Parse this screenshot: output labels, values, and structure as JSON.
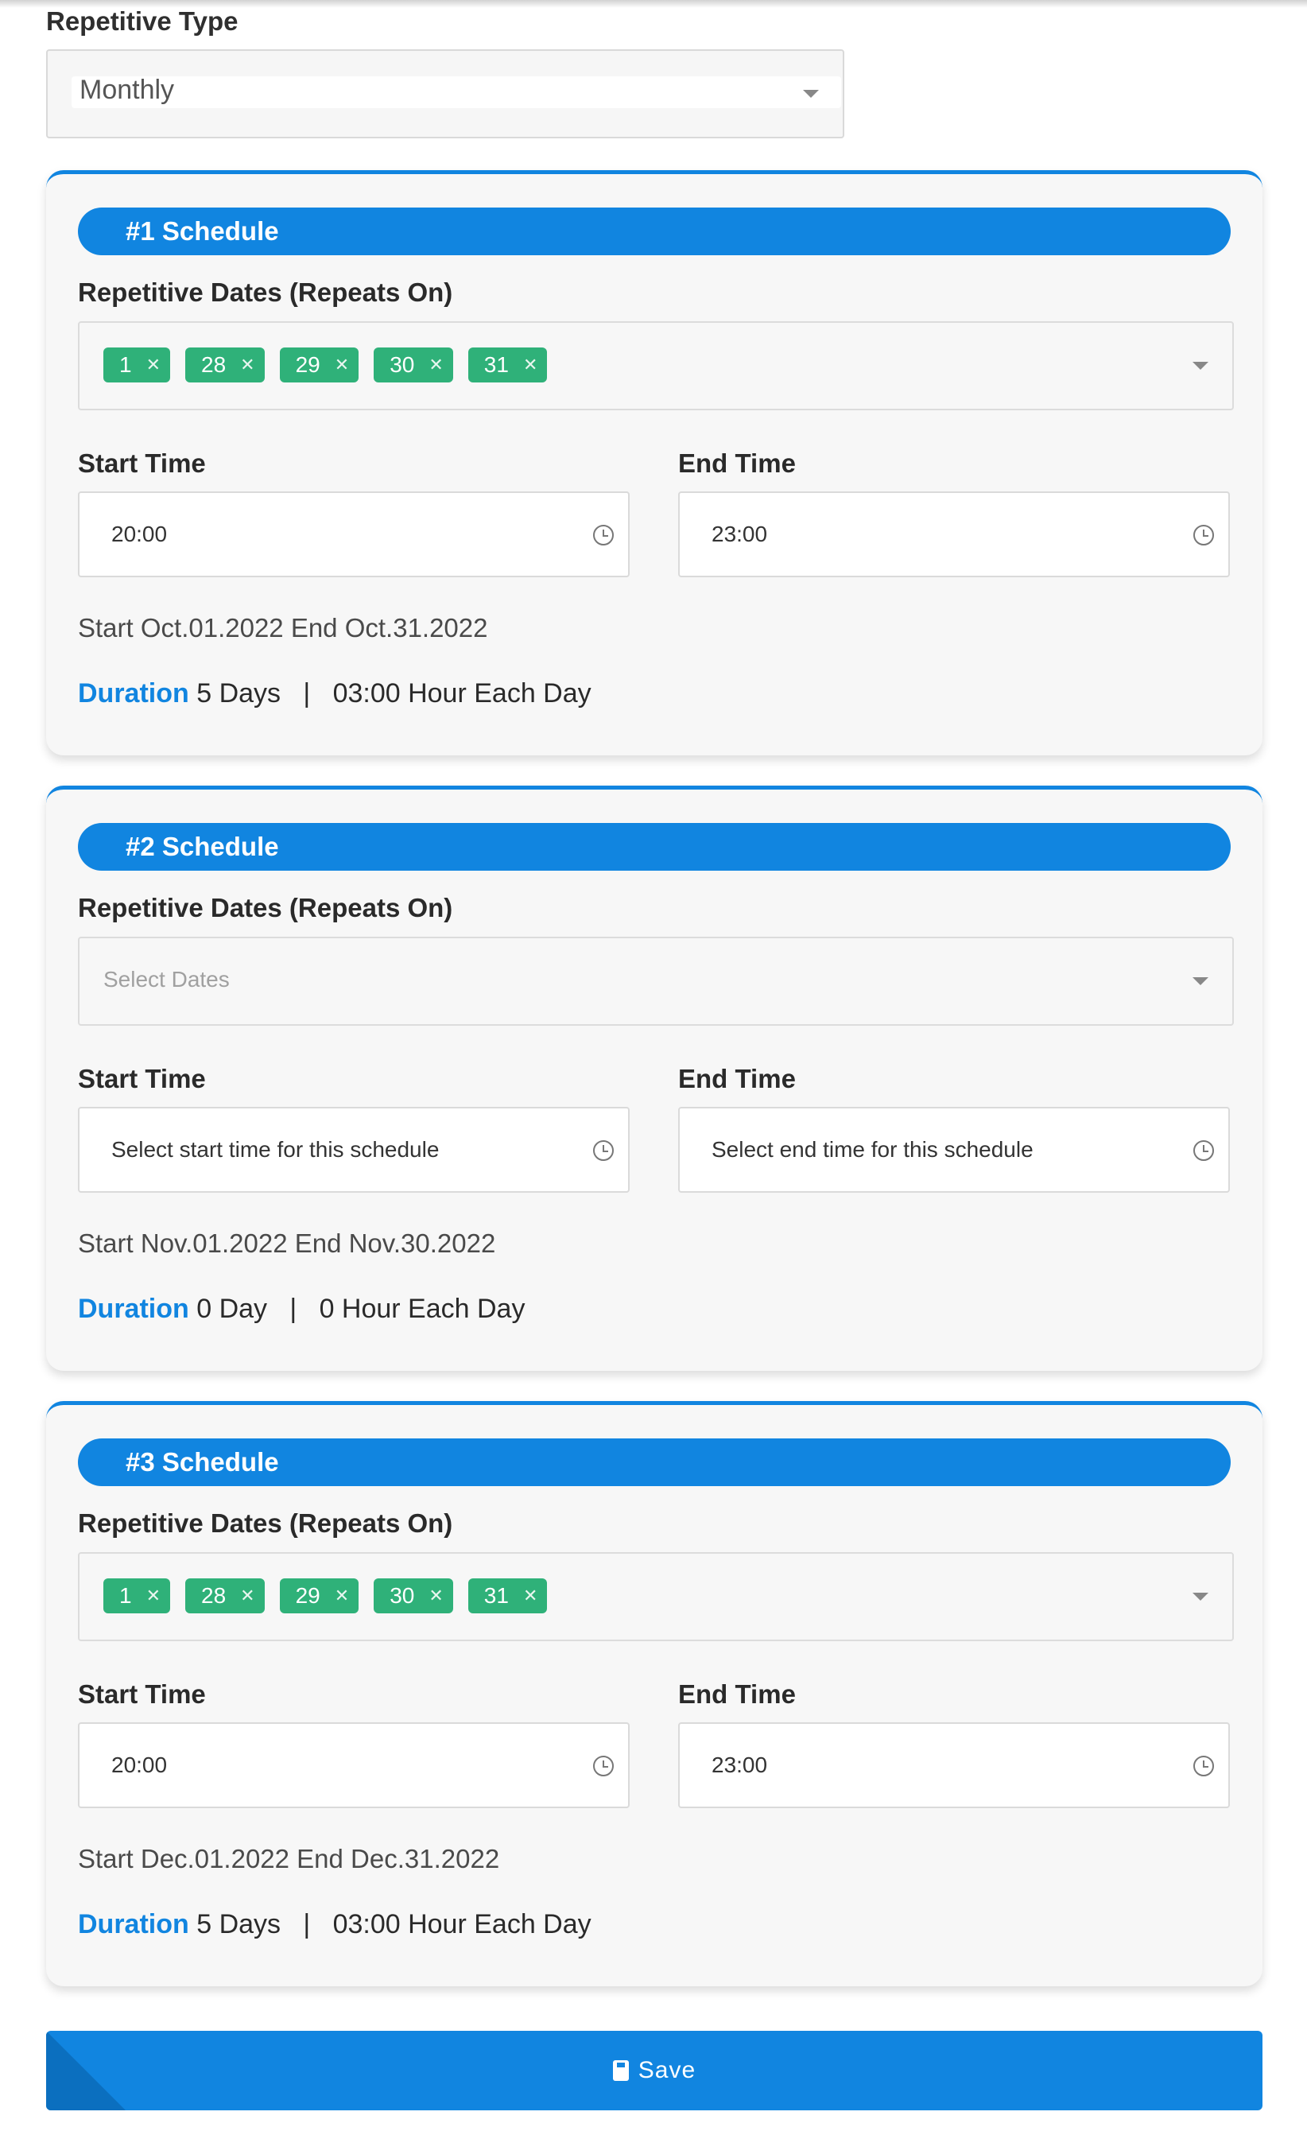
{
  "repetitive_type": {
    "label": "Repetitive Type",
    "value": "Monthly"
  },
  "schedules": [
    {
      "title": "#1 Schedule",
      "dates_label": "Repetitive Dates (Repeats On)",
      "dates": [
        "1",
        "28",
        "29",
        "30",
        "31"
      ],
      "dates_placeholder": "",
      "start_label": "Start Time",
      "start_time": "20:00",
      "end_label": "End Time",
      "end_time": "23:00",
      "range": "Start Oct.01.2022 End Oct.31.2022",
      "duration_label": "Duration",
      "duration_days": " 5 Days",
      "separator": "   |   ",
      "hours": "03:00 Hour Each Day"
    },
    {
      "title": "#2 Schedule",
      "dates_label": "Repetitive Dates (Repeats On)",
      "dates": [],
      "dates_placeholder": "Select Dates",
      "start_label": "Start Time",
      "start_time": "Select start time for this schedule",
      "end_label": "End Time",
      "end_time": "Select end time for this schedule",
      "range": "Start Nov.01.2022 End Nov.30.2022",
      "duration_label": "Duration",
      "duration_days": " 0 Day",
      "separator": "   |   ",
      "hours": "0 Hour Each Day"
    },
    {
      "title": "#3 Schedule",
      "dates_label": "Repetitive Dates (Repeats On)",
      "dates": [
        "1",
        "28",
        "29",
        "30",
        "31"
      ],
      "dates_placeholder": "",
      "start_label": "Start Time",
      "start_time": "20:00",
      "end_label": "End Time",
      "end_time": "23:00",
      "range": "Start Dec.01.2022 End Dec.31.2022",
      "duration_label": "Duration",
      "duration_days": " 5 Days",
      "separator": "   |   ",
      "hours": "03:00 Hour Each Day"
    }
  ],
  "save_button": {
    "label": "Save",
    "icon": "save-icon"
  },
  "colors": {
    "accent": "#1185e0",
    "chip": "#2fb179",
    "card_bg": "#f7f7f7"
  }
}
